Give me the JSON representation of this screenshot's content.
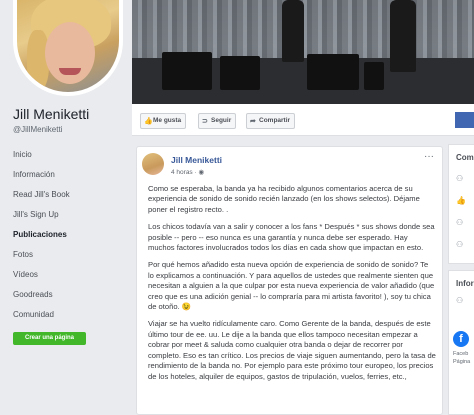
{
  "profile": {
    "name": "Jill Meniketti",
    "handle": "@JillMeniketti"
  },
  "nav": {
    "items": [
      {
        "label": "Inicio",
        "active": false
      },
      {
        "label": "Información",
        "active": false
      },
      {
        "label": "Read Jill's Book",
        "active": false
      },
      {
        "label": "Jill's Sign Up",
        "active": false
      },
      {
        "label": "Publicaciones",
        "active": true
      },
      {
        "label": "Fotos",
        "active": false
      },
      {
        "label": "Vídeos",
        "active": false
      },
      {
        "label": "Goodreads",
        "active": false
      },
      {
        "label": "Comunidad",
        "active": false
      }
    ],
    "create_page_label": "Crear una página"
  },
  "actions": {
    "like_label": "Me gusta",
    "like_icon": "thumbs-up-icon",
    "follow_label": "Seguir",
    "follow_icon": "rss-icon",
    "share_label": "Compartir",
    "share_icon": "share-arrow-icon"
  },
  "post": {
    "author": "Jill Meniketti",
    "time": "4 horas · ",
    "time_icon": "globe-icon",
    "menu": "···",
    "paragraphs": [
      "Como se esperaba, la banda ya ha recibido algunos comentarios acerca de su experiencia de sonido de sonido recién lanzado (en los shows selectos). Déjame poner el registro recto. .",
      "Los chicos todavía van a salir y conocer a los fans * Después * sus shows donde sea posible -- pero -- eso nunca es una garantía y nunca debe ser esperado. Hay muchos factores involucrados todos los días en cada show que impactan en esto.",
      "Por qué hemos añadido esta nueva opción de experiencia de sonido de sonido? Te lo explicamos a continuación. Y para aquellos de ustedes que realmente sienten que necesitan a alguien a la que culpar por esta nueva experiencia de valor añadido (que creo que es una adición genial -- lo compraría para mi artista favorito! ), soy tu chica de otoño. 😉",
      "Viajar se ha vuelto ridículamente caro. Como Gerente de la banda, después de este último tour de ee. uu. Le dije a la banda que ellos tampoco necesitan empezar a cobrar por meet & saluda como cualquier otra banda o dejar de recorrer por completo. Eso es tan crítico. Los precios de viaje siguen aumentando, pero la tasa de rendimiento de la banda no. Por ejemplo para este próximo tour europeo, los precios de los hoteles, alquiler de equipos, gastos de tripulación, vuelos, ferries, etc.,"
    ]
  },
  "right_column": {
    "community_title": "Com",
    "info_title": "Infor",
    "info_small_text": "Faceb",
    "info_small_text_2": "Página",
    "community_icons": [
      "people-icon",
      "thumbs-up-icon",
      "people-icon",
      "people-icon"
    ],
    "facebook_icon": "facebook-icon",
    "facebook_letter": "f"
  }
}
